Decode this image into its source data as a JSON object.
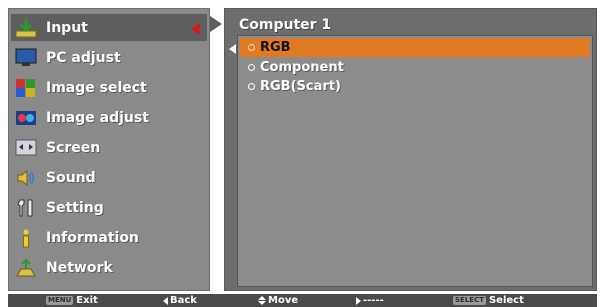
{
  "main_menu": {
    "items": [
      {
        "label": "Input",
        "icon": "input-icon"
      },
      {
        "label": "PC adjust",
        "icon": "monitor-icon"
      },
      {
        "label": "Image select",
        "icon": "image-select-icon"
      },
      {
        "label": "Image adjust",
        "icon": "image-adjust-icon"
      },
      {
        "label": "Screen",
        "icon": "screen-icon"
      },
      {
        "label": "Sound",
        "icon": "speaker-icon"
      },
      {
        "label": "Setting",
        "icon": "wrench-icon"
      },
      {
        "label": "Information",
        "icon": "info-icon"
      },
      {
        "label": "Network",
        "icon": "network-icon"
      }
    ],
    "selected_index": 0
  },
  "submenu": {
    "title": "Computer 1",
    "options": [
      {
        "label": "RGB"
      },
      {
        "label": "Component"
      },
      {
        "label": "RGB(Scart)"
      }
    ],
    "selected_index": 0
  },
  "help_bar": {
    "exit_key": "MENU",
    "exit_label": "Exit",
    "back_label": "Back",
    "move_label": "Move",
    "next_label": "-----",
    "select_key": "SELECT",
    "select_label": "Select"
  },
  "colors": {
    "left_panel": "#8a8a8a",
    "right_panel": "#6d6d6d",
    "highlight": "#e07b24",
    "pointer_arrow": "#d81818",
    "help_bar": "#4a4a4a"
  }
}
